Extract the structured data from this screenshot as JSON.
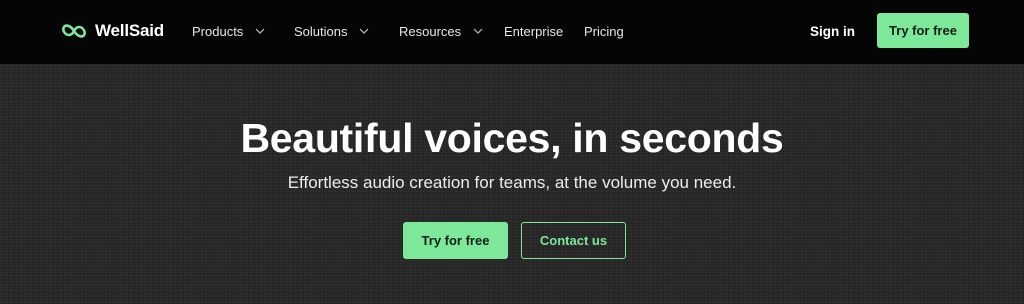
{
  "brand": {
    "name": "WellSaid",
    "logo_icon": "wellsaid-infinity-logo",
    "accent_color": "#7ee89a"
  },
  "nav": {
    "items": [
      {
        "label": "Products",
        "has_dropdown": true
      },
      {
        "label": "Solutions",
        "has_dropdown": true
      },
      {
        "label": "Resources",
        "has_dropdown": true
      },
      {
        "label": "Enterprise",
        "has_dropdown": false
      },
      {
        "label": "Pricing",
        "has_dropdown": false
      }
    ],
    "sign_in_label": "Sign in",
    "cta_label": "Try for free"
  },
  "hero": {
    "headline": "Beautiful voices, in seconds",
    "subheadline": "Effortless audio creation for teams, at the volume you need.",
    "primary_cta_label": "Try for free",
    "secondary_cta_label": "Contact us"
  },
  "colors": {
    "nav_background": "#050505",
    "hero_background": "#262626",
    "accent": "#7ee89a"
  }
}
